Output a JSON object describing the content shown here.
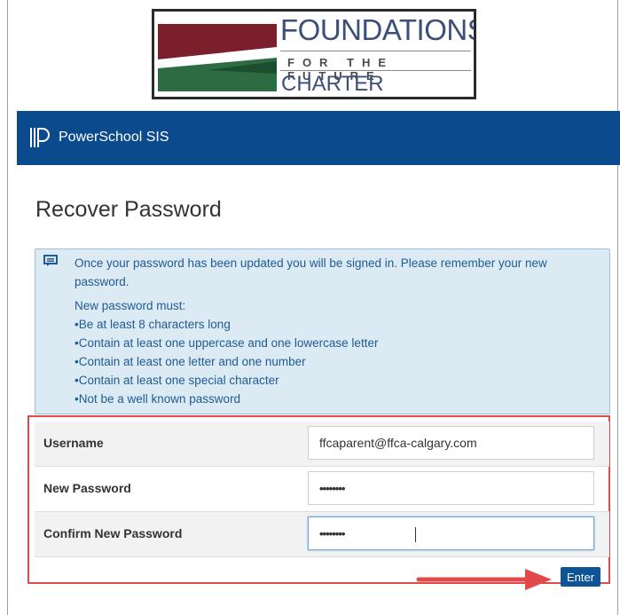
{
  "logo": {
    "line1": "FOUNDATIONS",
    "line2": "FOR THE FUTURE",
    "line3": "CHARTER ACADEMY",
    "colors": {
      "maroon": "#7a1f2b",
      "green": "#2d6b42",
      "navy": "#3b4f7a"
    }
  },
  "header": {
    "brand": "PowerSchool SIS",
    "icon": "powerschool-logo-icon",
    "color": "#0b4a8c"
  },
  "page": {
    "title": "Recover Password"
  },
  "info": {
    "icon": "message-icon",
    "intro": "Once your password has been updated you will be signed in. Please remember your new password.",
    "rules_heading": "New password must:",
    "rules": [
      "•Be at least 8 characters long",
      "•Contain at least one uppercase and one lowercase letter",
      "•Contain at least one letter and one number",
      "•Contain at least one special character",
      "•Not be a well known password"
    ]
  },
  "form": {
    "username_label": "Username",
    "username_value": "ffcaparent@ffca-calgary.com",
    "new_password_label": "New Password",
    "new_password_value": "••••••••",
    "confirm_password_label": "Confirm New Password",
    "confirm_password_value": "••••••••",
    "highlight_color": "#e24a4a"
  },
  "actions": {
    "enter_label": "Enter",
    "arrow_color": "#e24a4a"
  }
}
